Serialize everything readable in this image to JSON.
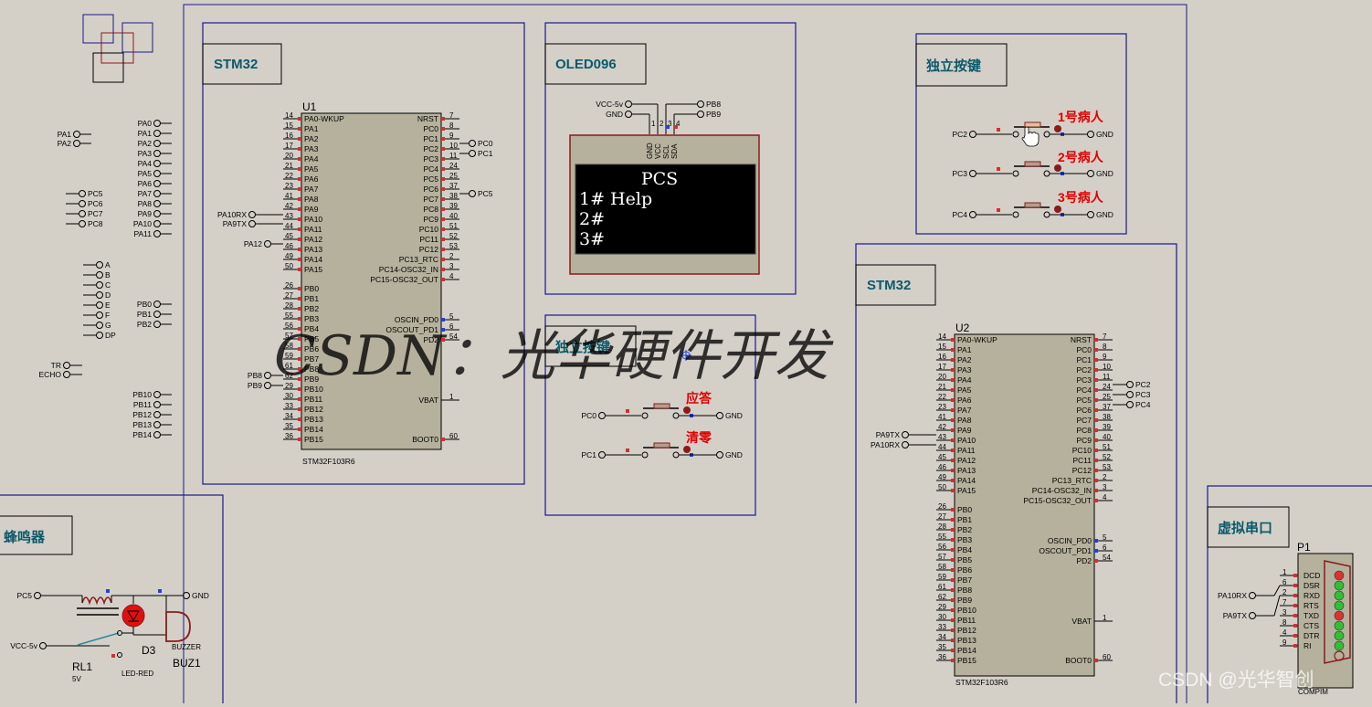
{
  "headers": {
    "stm32_u1": "STM32",
    "oled": "OLED096",
    "keys_top": "独立按键",
    "stm32_u2": "STM32",
    "keys_mid": "独立按键",
    "buzzer": "蜂鸣器",
    "vserial": "虚拟串口"
  },
  "u1": {
    "ref": "U1",
    "part": "STM32F103R6",
    "left_pins": [
      {
        "name": "PA0-WKUP",
        "num": "14"
      },
      {
        "name": "PA1",
        "num": "15"
      },
      {
        "name": "PA2",
        "num": "16"
      },
      {
        "name": "PA3",
        "num": "17"
      },
      {
        "name": "PA4",
        "num": "20"
      },
      {
        "name": "PA5",
        "num": "21"
      },
      {
        "name": "PA6",
        "num": "22"
      },
      {
        "name": "PA7",
        "num": "23"
      },
      {
        "name": "PA8",
        "num": "41"
      },
      {
        "name": "PA9",
        "num": "42"
      },
      {
        "name": "PA10",
        "num": "43"
      },
      {
        "name": "PA11",
        "num": "44"
      },
      {
        "name": "PA12",
        "num": "45"
      },
      {
        "name": "PA13",
        "num": "46"
      },
      {
        "name": "PA14",
        "num": "49"
      },
      {
        "name": "PA15",
        "num": "50"
      },
      {
        "name": "PB0",
        "num": "26"
      },
      {
        "name": "PB1",
        "num": "27"
      },
      {
        "name": "PB2",
        "num": "28"
      },
      {
        "name": "PB3",
        "num": "55"
      },
      {
        "name": "PB4",
        "num": "56"
      },
      {
        "name": "PB5",
        "num": "57"
      },
      {
        "name": "PB6",
        "num": "58"
      },
      {
        "name": "PB7",
        "num": "59"
      },
      {
        "name": "PB8",
        "num": "61"
      },
      {
        "name": "PB9",
        "num": "62"
      },
      {
        "name": "PB10",
        "num": "29"
      },
      {
        "name": "PB11",
        "num": "30"
      },
      {
        "name": "PB12",
        "num": "33"
      },
      {
        "name": "PB13",
        "num": "34"
      },
      {
        "name": "PB14",
        "num": "35"
      },
      {
        "name": "PB15",
        "num": "36"
      }
    ],
    "right_pins_top": [
      {
        "name": "NRST",
        "num": "7"
      },
      {
        "name": "PC0",
        "num": "8"
      },
      {
        "name": "PC1",
        "num": "9"
      },
      {
        "name": "PC2",
        "num": "10"
      },
      {
        "name": "PC3",
        "num": "11"
      },
      {
        "name": "PC4",
        "num": "24"
      },
      {
        "name": "PC5",
        "num": "25"
      },
      {
        "name": "PC6",
        "num": "37"
      },
      {
        "name": "PC7",
        "num": "38"
      },
      {
        "name": "PC8",
        "num": "39"
      },
      {
        "name": "PC9",
        "num": "40"
      },
      {
        "name": "PC10",
        "num": "51"
      },
      {
        "name": "PC11",
        "num": "52"
      },
      {
        "name": "PC12",
        "num": "53"
      },
      {
        "name": "PC13_RTC",
        "num": "2"
      },
      {
        "name": "PC14-OSC32_IN",
        "num": "3"
      },
      {
        "name": "PC15-OSC32_OUT",
        "num": "4"
      }
    ],
    "right_pins_mid": [
      {
        "name": "OSCIN_PD0",
        "num": "5"
      },
      {
        "name": "OSCOUT_PD1",
        "num": "6"
      },
      {
        "name": "PD2",
        "num": "54"
      }
    ],
    "vbat": {
      "name": "VBAT",
      "num": "1"
    },
    "boot0": {
      "name": "BOOT0",
      "num": "60"
    },
    "terminals": {
      "pc0": "PC0",
      "pc1": "PC1",
      "pc5": "PC5",
      "pa10rx": "PA10RX",
      "pa9tx": "PA9TX",
      "pa12": "PA12",
      "pb8": "PB8",
      "pb9": "PB9"
    }
  },
  "u2": {
    "ref": "U2",
    "part": "STM32F103R6",
    "terminals": {
      "pc2": "PC2",
      "pc3": "PC3",
      "pc4": "PC4",
      "pa9tx": "PA9TX",
      "pa10rx": "PA10RX"
    }
  },
  "oled": {
    "terminals": {
      "vcc": "VCC-5v",
      "gnd": "GND",
      "pb8": "PB8",
      "pb9": "PB9"
    },
    "pins": [
      "GND",
      "VCC",
      "SCL",
      "SDA"
    ],
    "pin_nums": [
      "1",
      "2",
      "3",
      "4"
    ],
    "screen_lines": [
      "PCS",
      "1# Help",
      "2#",
      "3#"
    ]
  },
  "keys_top": {
    "rows": [
      {
        "term": "PC2",
        "label": "1号病人",
        "gnd": "GND"
      },
      {
        "term": "PC3",
        "label": "2号病人",
        "gnd": "GND"
      },
      {
        "term": "PC4",
        "label": "3号病人",
        "gnd": "GND"
      }
    ]
  },
  "keys_mid": {
    "rows": [
      {
        "term": "PC0",
        "label": "应答",
        "gnd": "GND"
      },
      {
        "term": "PC1",
        "label": "清零",
        "gnd": "GND"
      }
    ]
  },
  "left_terms": {
    "pa_small": [
      "PA1",
      "PA2"
    ],
    "pa_list": [
      "PA0",
      "PA1",
      "PA2",
      "PA3",
      "PA4",
      "PA5",
      "PA6",
      "PA7",
      "PA8",
      "PA9",
      "PA10",
      "PA11"
    ],
    "pc_list": [
      "PC5",
      "PC6",
      "PC7",
      "PC8"
    ],
    "seg_list": [
      "A",
      "B",
      "C",
      "D",
      "E",
      "F",
      "G",
      "DP"
    ],
    "pb_small": [
      "PB0",
      "PB1",
      "PB2"
    ],
    "trecho": [
      "TR",
      "ECHO"
    ],
    "pb_list": [
      "PB10",
      "PB11",
      "PB12",
      "PB13",
      "PB14"
    ]
  },
  "buzzer": {
    "pc5": "PC5",
    "gnd": "GND",
    "vcc": "VCC-5v",
    "rl1": "RL1",
    "rl1_val": "5V",
    "d3": "D3",
    "led": "LED-RED",
    "buzzer_type": "BUZZER",
    "buz1": "BUZ1"
  },
  "vserial": {
    "ref": "P1",
    "part": "COMPIM",
    "pins": [
      {
        "name": "DCD",
        "num": "1"
      },
      {
        "name": "DSR",
        "num": "6"
      },
      {
        "name": "RXD",
        "num": "2"
      },
      {
        "name": "RTS",
        "num": "7"
      },
      {
        "name": "TXD",
        "num": "3"
      },
      {
        "name": "CTS",
        "num": "8"
      },
      {
        "name": "DTR",
        "num": "4"
      },
      {
        "name": "RI",
        "num": "9"
      }
    ],
    "terms": {
      "pa10rx": "PA10RX",
      "pa9tx": "PA9TX"
    },
    "led_colors": [
      "#e03030",
      "#30c030",
      "#30c030",
      "#30c030",
      "#e03030",
      "#30c030",
      "#30c030",
      "#30c030"
    ]
  },
  "overlay": {
    "watermark": "CSDN：光华硬件开发",
    "credit": "CSDN @光华智创"
  },
  "colors": {
    "frame": "#1a1a8c",
    "chip": "#b5b19c",
    "wire": "#000000",
    "red": "#e00000",
    "header_text": "#0b5a6b"
  }
}
